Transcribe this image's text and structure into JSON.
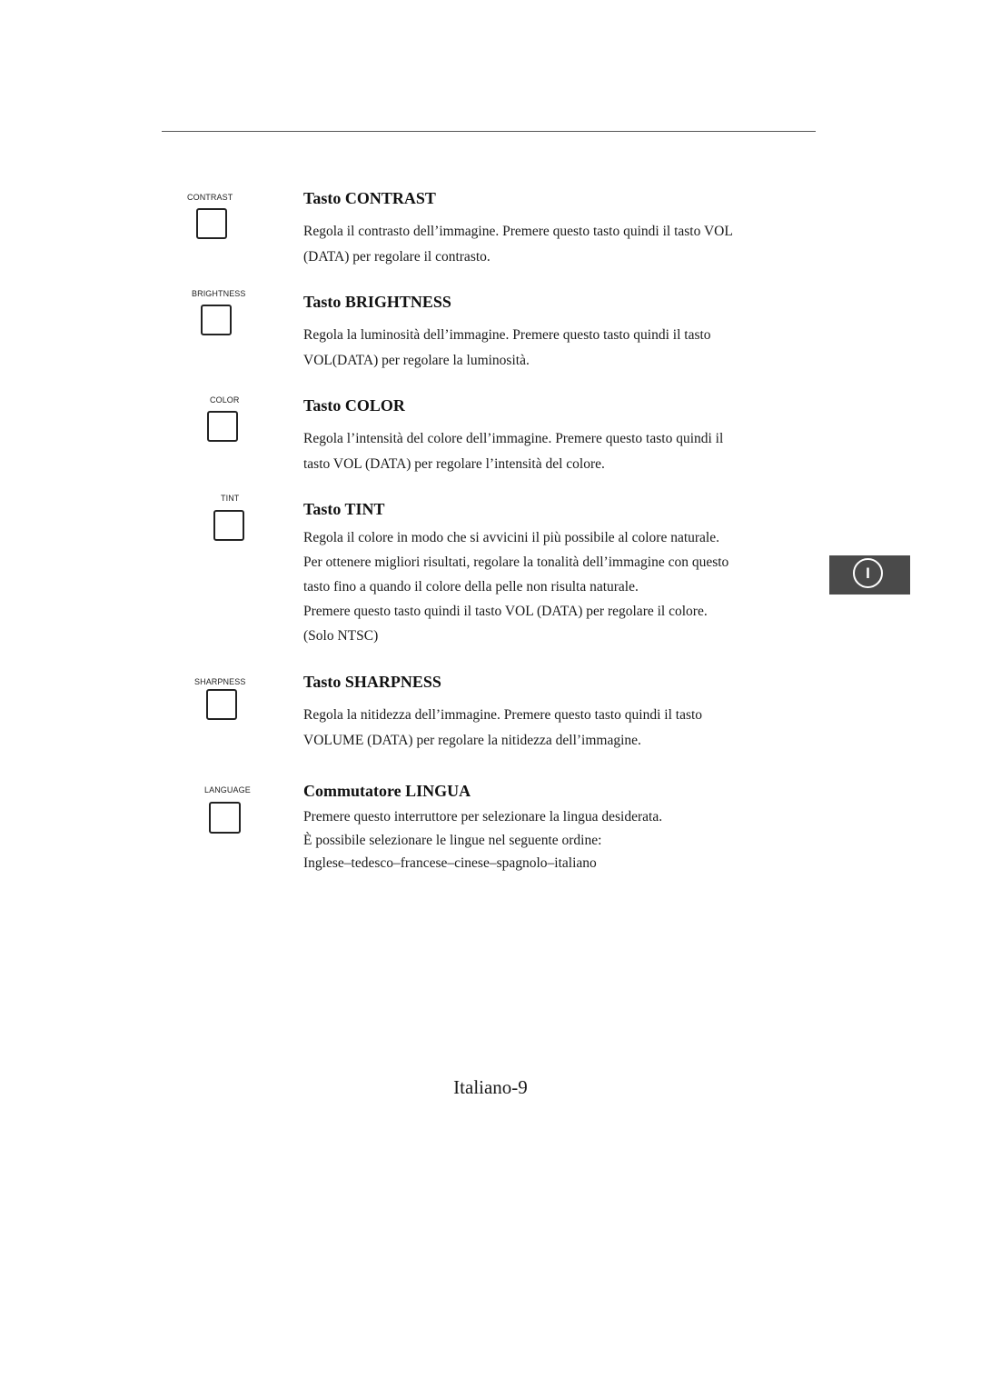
{
  "document": {
    "language_tab": "I",
    "page_number": "Italiano-9",
    "sections": [
      {
        "button_label": "CONTRAST",
        "heading": "Tasto CONTRAST",
        "lines": [
          "Regola il contrasto dell’immagine. Premere questo tasto quindi il tasto VOL",
          "(DATA) per regolare il contrasto."
        ]
      },
      {
        "button_label": "BRIGHTNESS",
        "heading": "Tasto BRIGHTNESS",
        "lines": [
          "Regola la luminosità dell’immagine. Premere questo tasto quindi il tasto",
          "VOL(DATA) per regolare la luminosità."
        ]
      },
      {
        "button_label": "COLOR",
        "heading": "Tasto COLOR",
        "lines": [
          "Regola l’intensità del colore dell’immagine. Premere questo tasto quindi il",
          "tasto VOL (DATA) per regolare l’intensità del colore."
        ]
      },
      {
        "button_label": "TINT",
        "heading": "Tasto TINT",
        "lines": [
          "Regola il colore in modo che si avvicini il più possibile al colore naturale.",
          "Per ottenere migliori risultati, regolare la tonalità dell’immagine con questo",
          "tasto fino a quando il colore della pelle non risulta naturale.",
          "Premere questo tasto quindi il tasto VOL (DATA) per regolare il colore.",
          "(Solo NTSC)"
        ]
      },
      {
        "button_label": "SHARPNESS",
        "heading": "Tasto SHARPNESS",
        "lines": [
          "Regola la nitidezza dell’immagine. Premere questo tasto quindi il tasto",
          "VOLUME (DATA) per regolare la nitidezza dell’immagine."
        ]
      },
      {
        "button_label": "LANGUAGE",
        "heading": "Commutatore LINGUA",
        "lines": [
          "Premere questo interruttore per selezionare la lingua desiderata.",
          "È possibile selezionare le lingue nel seguente ordine:",
          "Inglese–tedesco–francese–cinese–spagnolo–italiano"
        ]
      }
    ]
  }
}
